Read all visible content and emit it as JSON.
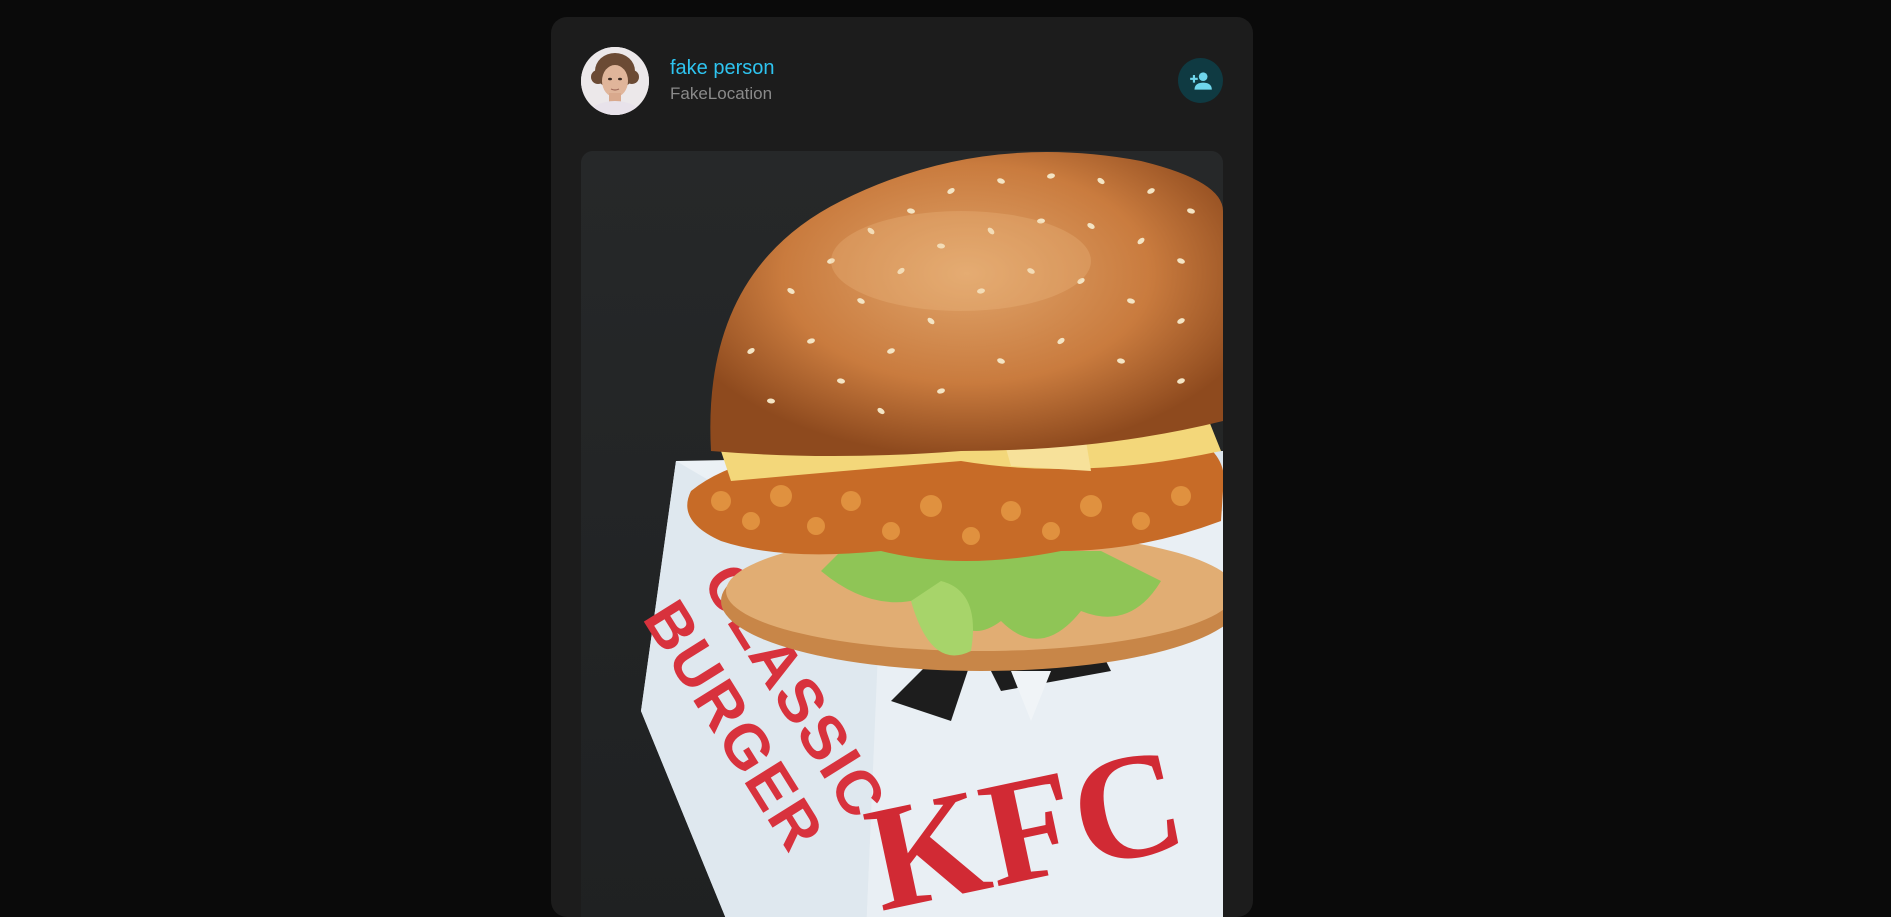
{
  "post": {
    "author": {
      "name": "fake person",
      "location": "FakeLocation",
      "avatar_icon": "person-portrait"
    },
    "follow_button_icon": "person-add-icon",
    "image": {
      "subject": "chicken burger on KFC box",
      "box_text_left": "CLASSIC BURGER",
      "box_text_right": "KFC"
    }
  },
  "colors": {
    "background": "#0a0a0a",
    "card": "#1c1c1c",
    "accent": "#2ec4f0",
    "follow_button_bg": "#0f3a42",
    "follow_icon": "#6fd6ec",
    "muted_text": "#8a8a8a"
  }
}
